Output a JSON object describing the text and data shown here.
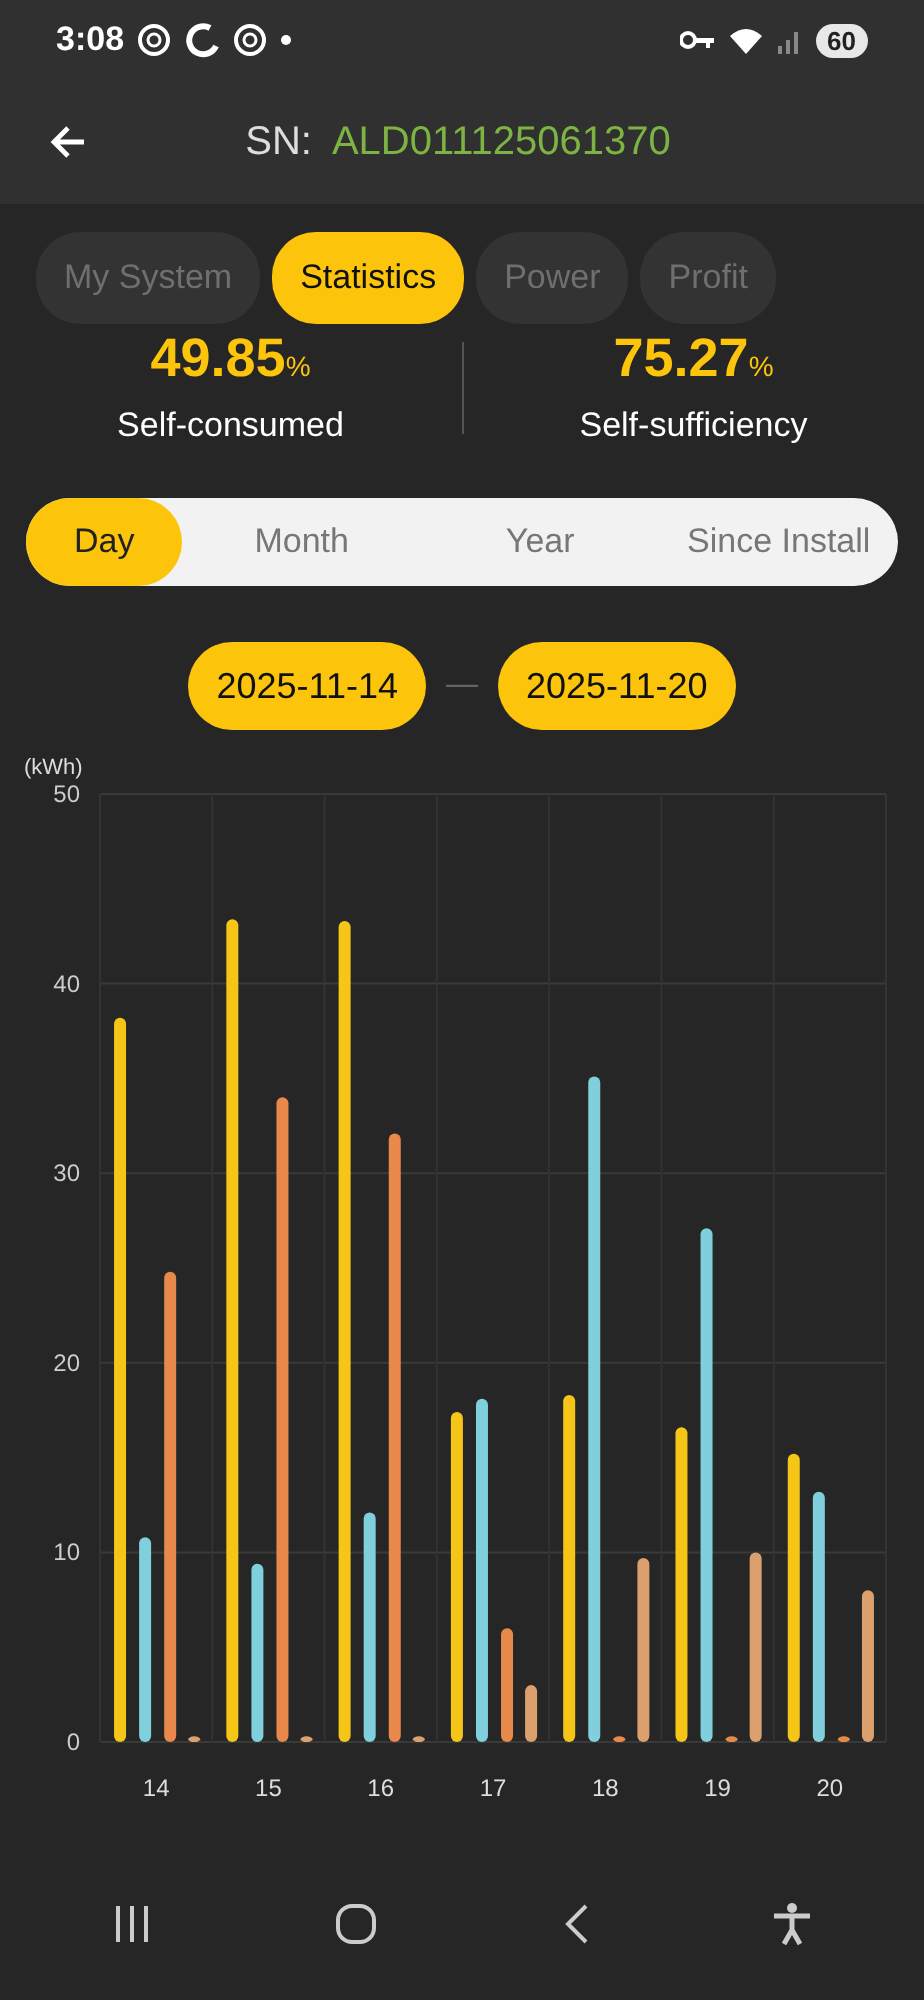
{
  "status_bar": {
    "time": "3:08",
    "battery": "60"
  },
  "header": {
    "label": "SN:",
    "serial": "ALD011125061370"
  },
  "tabs": [
    {
      "label": "My System",
      "selected": false
    },
    {
      "label": "Statistics",
      "selected": true
    },
    {
      "label": "Power",
      "selected": false
    },
    {
      "label": "Profit",
      "selected": false
    }
  ],
  "stats": [
    {
      "value": "49.85",
      "unit": "%",
      "label": "Self-consumed"
    },
    {
      "value": "75.27",
      "unit": "%",
      "label": "Self-sufficiency"
    }
  ],
  "periods": [
    {
      "label": "Day",
      "selected": true
    },
    {
      "label": "Month",
      "selected": false
    },
    {
      "label": "Year",
      "selected": false
    },
    {
      "label": "Since Install",
      "selected": false
    }
  ],
  "date_range": {
    "start": "2025-11-14",
    "separator": "—",
    "end": "2025-11-20"
  },
  "chart": {
    "chart_data": {
      "type": "bar",
      "ylabel": "(kWh)",
      "categories": [
        "14",
        "15",
        "16",
        "17",
        "18",
        "19",
        "20"
      ],
      "ylim": [
        0,
        50
      ],
      "grid": true,
      "yticks": [
        0,
        10,
        20,
        30,
        40,
        50
      ],
      "series": [
        {
          "color": "#f5c518",
          "values": [
            38.2,
            43.4,
            43.3,
            17.4,
            18.3,
            16.6,
            15.2
          ]
        },
        {
          "color": "#7fd0dc",
          "values": [
            10.8,
            9.4,
            12.1,
            18.1,
            35.1,
            27.1,
            13.2
          ]
        },
        {
          "color": "#e8884a",
          "values": [
            24.8,
            34.0,
            32.1,
            6.0,
            0.3,
            0.3,
            0.3
          ]
        },
        {
          "color": "#dba06e",
          "values": [
            0.3,
            0.3,
            0.3,
            3.0,
            9.7,
            10.0,
            8.0
          ]
        }
      ]
    }
  }
}
